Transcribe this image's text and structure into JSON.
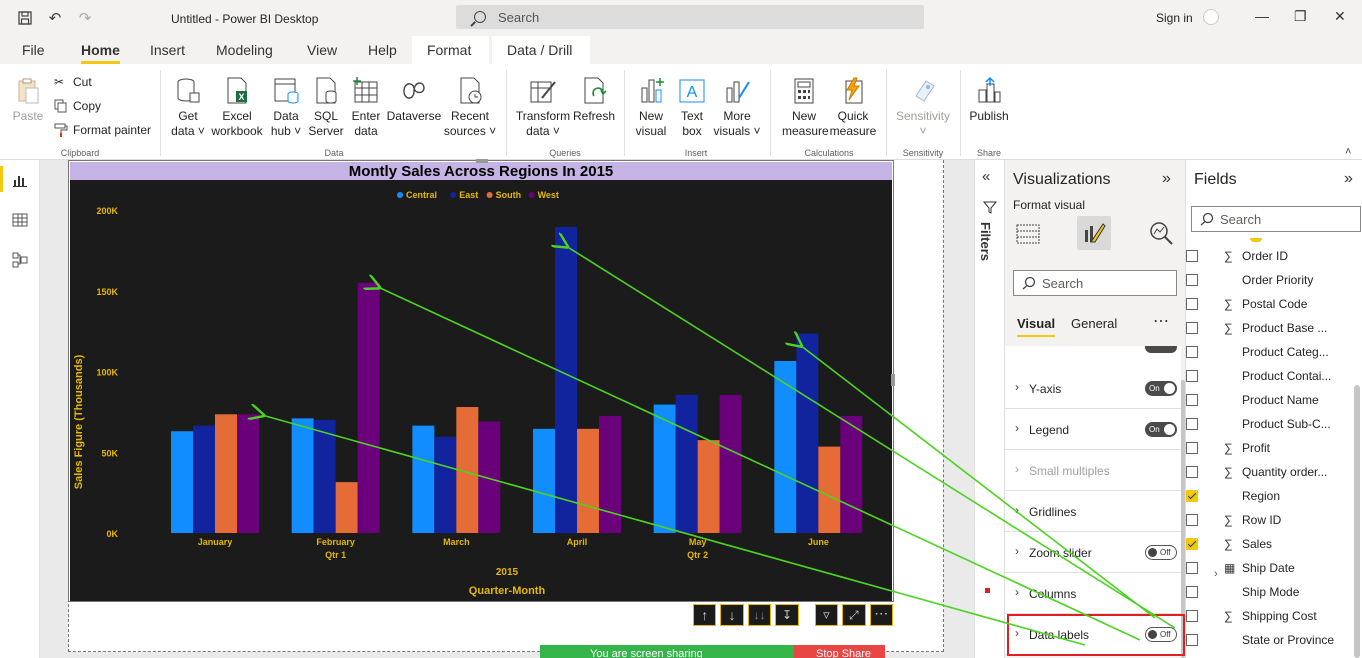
{
  "window": {
    "title": "Untitled - Power BI Desktop",
    "search_placeholder": "Search",
    "signin": "Sign in"
  },
  "tabs": [
    "File",
    "Home",
    "Insert",
    "Modeling",
    "View",
    "Help",
    "Format",
    "Data / Drill"
  ],
  "ribbon": {
    "clipboard": {
      "paste": "Paste",
      "cut": "Cut",
      "copy": "Copy",
      "format_painter": "Format painter",
      "label": "Clipboard"
    },
    "data": {
      "get_data": [
        "Get",
        "data"
      ],
      "excel": [
        "Excel",
        "workbook"
      ],
      "hub": [
        "Data",
        "hub"
      ],
      "sql": [
        "SQL",
        "Server"
      ],
      "enter": [
        "Enter",
        "data"
      ],
      "dataverse": "Dataverse",
      "recent": [
        "Recent",
        "sources"
      ],
      "label": "Data"
    },
    "queries": {
      "transform": [
        "Transform",
        "data"
      ],
      "refresh": "Refresh",
      "label": "Queries"
    },
    "insert": {
      "new_visual": [
        "New",
        "visual"
      ],
      "text_box": [
        "Text",
        "box"
      ],
      "more_visuals": [
        "More",
        "visuals"
      ],
      "label": "Insert"
    },
    "calculations": {
      "new_measure": [
        "New",
        "measure"
      ],
      "quick_measure": [
        "Quick",
        "measure"
      ],
      "label": "Calculations"
    },
    "sensitivity": {
      "btn": "Sensitivity",
      "label": "Sensitivity"
    },
    "share": {
      "publish": "Publish",
      "label": "Share"
    }
  },
  "chart_data": {
    "type": "bar",
    "title": "Montly Sales Across Regions In 2015",
    "xlabel": "Quarter-Month",
    "ylabel": "Sales Figure (Thousands)",
    "year_label": "2015",
    "ylim": [
      0,
      200000
    ],
    "yticks": [
      "0K",
      "50K",
      "100K",
      "150K",
      "200K"
    ],
    "categories": [
      "January",
      "February",
      "March",
      "April",
      "May",
      "June"
    ],
    "quarters": [
      {
        "label": "Qtr 1",
        "under": 1
      },
      {
        "label": "Qtr 2",
        "under": 4
      }
    ],
    "legend_position": "top-center",
    "series": [
      {
        "name": "Central",
        "color": "#118dff",
        "values": [
          63000,
          71000,
          66500,
          64500,
          79500,
          106500
        ]
      },
      {
        "name": "East",
        "color": "#12239e",
        "values": [
          66500,
          70000,
          59500,
          189500,
          85500,
          123500
        ]
      },
      {
        "name": "South",
        "color": "#e66c37",
        "values": [
          73500,
          31500,
          78000,
          64500,
          57500,
          53500
        ]
      },
      {
        "name": "West",
        "color": "#6b007b",
        "values": [
          73500,
          155000,
          69000,
          72500,
          85500,
          72500
        ]
      }
    ]
  },
  "filters_label": "Filters",
  "viz": {
    "title": "Visualizations",
    "format_visual": "Format visual",
    "search_placeholder": "Search",
    "tab_visual": "Visual",
    "tab_general": "General",
    "sections": [
      {
        "label": "Y-axis",
        "toggle": "On"
      },
      {
        "label": "Legend",
        "toggle": "On"
      },
      {
        "label": "Small multiples",
        "toggle": null,
        "dim": true
      },
      {
        "label": "Gridlines",
        "toggle": null
      },
      {
        "label": "Zoom slider",
        "toggle": "Off"
      },
      {
        "label": "Columns",
        "toggle": null
      },
      {
        "label": "Data labels",
        "toggle": "Off"
      }
    ]
  },
  "fields": {
    "title": "Fields",
    "search_placeholder": "Search",
    "items": [
      {
        "name": "Order ID",
        "sigma": true,
        "checked": false
      },
      {
        "name": "Order Priority",
        "sigma": false,
        "checked": false
      },
      {
        "name": "Postal Code",
        "sigma": true,
        "checked": false
      },
      {
        "name": "Product Base ...",
        "sigma": true,
        "checked": false
      },
      {
        "name": "Product Categ...",
        "sigma": false,
        "checked": false
      },
      {
        "name": "Product Contai...",
        "sigma": false,
        "checked": false
      },
      {
        "name": "Product Name",
        "sigma": false,
        "checked": false
      },
      {
        "name": "Product Sub-C...",
        "sigma": false,
        "checked": false
      },
      {
        "name": "Profit",
        "sigma": true,
        "checked": false
      },
      {
        "name": "Quantity order...",
        "sigma": true,
        "checked": false
      },
      {
        "name": "Region",
        "sigma": false,
        "checked": true
      },
      {
        "name": "Row ID",
        "sigma": true,
        "checked": false
      },
      {
        "name": "Sales",
        "sigma": true,
        "checked": true
      },
      {
        "name": "Ship Date",
        "sigma": false,
        "checked": false,
        "calendar": true
      },
      {
        "name": "Ship Mode",
        "sigma": false,
        "checked": false
      },
      {
        "name": "Shipping Cost",
        "sigma": true,
        "checked": false
      },
      {
        "name": "State or Province",
        "sigma": false,
        "checked": false
      }
    ]
  },
  "share_banner": {
    "text": "You are screen sharing",
    "stop": "Stop Share"
  },
  "colors": {
    "accent": "#f2c811",
    "chart_bg": "#1b1b1b",
    "title_band": "#c6b3e6",
    "label_gold": "#e6b800",
    "arrow": "#4cd321",
    "highlight": "#e02020"
  }
}
